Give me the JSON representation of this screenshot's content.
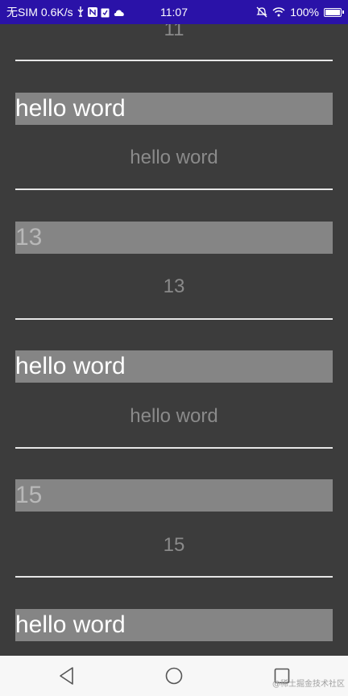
{
  "status_bar": {
    "carrier": "无SIM",
    "speed": "0.6K/s",
    "time": "11:07",
    "battery": "100%",
    "battery_level": 1.0,
    "icons": [
      "usb-icon",
      "nfc-icon",
      "clipboard-icon",
      "cloud-icon",
      "mute-icon",
      "wifi-icon",
      "battery-icon"
    ]
  },
  "list": {
    "top_partial": "11",
    "items": [
      {
        "band": "hello word",
        "center": "hello word"
      },
      {
        "band": "13",
        "center": "13"
      },
      {
        "band": "hello word",
        "center": "hello word"
      },
      {
        "band": "15",
        "center": "15"
      },
      {
        "band": "hello word"
      }
    ]
  },
  "nav_bar": {
    "icons": [
      "back-icon",
      "home-icon",
      "recent-apps-icon"
    ],
    "watermark": "@稀土掘金技术社区"
  },
  "colors": {
    "status_bar": "#2a12a8",
    "background": "#3c3c3c",
    "band": "#858585",
    "nav_bar": "#f7f7f7"
  }
}
